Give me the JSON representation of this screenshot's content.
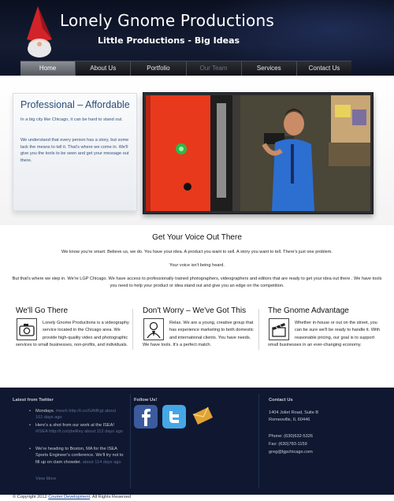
{
  "site": {
    "title": "Lonely Gnome Productions",
    "tagline": "Little Productions - Big Ideas"
  },
  "nav": {
    "items": [
      {
        "label": "Home",
        "active": true
      },
      {
        "label": "About Us"
      },
      {
        "label": "Portfolio"
      },
      {
        "label": "Our Team"
      },
      {
        "label": "Services"
      },
      {
        "label": "Contact Us"
      }
    ]
  },
  "intro": {
    "title": "Professional – Affordable",
    "p1": "In a big city like Chicago, it can be hard to stand out.",
    "p2": "We understand that every person has a story, but some lack the means to tell it. That's where we come in. We'll give you the tools to be seen and get your message out there."
  },
  "voice": {
    "title": "Get Your Voice Out There",
    "p1": "We know you're smart. Believe us, we do. You have your idea. A product you want to sell. A story you want to tell. There's just one problem.",
    "p2": "Your voice isn't being heard.",
    "p3": "But that's where we step in. We're LGP Chicago. We have access to professionally trained photographers, videographers and editors that are ready to get your idea out there . We have tools you need to help your product or idea stand out and give you an edge on the competition."
  },
  "columns": [
    {
      "title": "We'll Go There",
      "icon": "camera-icon",
      "text": "Lonely Gnome Productions is a videography service located in the Chicago area.  We provide high-quality video and photographic services to small businesses, non-profits, and individuals."
    },
    {
      "title": "Don't Worry – We've Got This",
      "icon": "person-icon",
      "text": "Relax. We are a young, creative group that has experience marketing to both domestic and international clients. You have needs. We have tools. It's a perfect match."
    },
    {
      "title": "The Gnome Advantage",
      "icon": "clapperboard-icon",
      "text": "Whether in-house or out on the street, you can be sure we'll be ready to handle it. With reasonable pricing, our goal is to support small businesses in an ever-changing economy."
    }
  ],
  "footer": {
    "twitter_heading": "Latest from Twitter",
    "tweets": [
      {
        "text": "Mondays.",
        "link": "#work http://t.co/GAtfKgt about 161 days ago"
      },
      {
        "text": "Here's a shot from our work at the ISEA!",
        "link": "#ISEA http://t.co/ybeRey about 112 days ago"
      },
      {
        "text": "We're heading to Boston, MA for the ISEA Sports Engineer's conference. We'll try not to fill up on clam chowder.",
        "link": "about 114 days ago"
      }
    ],
    "view_more": "View More",
    "follow_heading": "Follow Us!",
    "contact_heading": "Contact Us",
    "address1": "1404 Joliet Road, Suite B",
    "address2": "Romeoville, IL 60446",
    "phone": "Phone: (630)632-5326",
    "fax": "Fax: (630)783-1159",
    "email": "greg@lgpchicago.com"
  },
  "copyright": {
    "prefix": "© Copyright 2012",
    "link1": "Courier Development",
    "suffix": "All Rights Reserved"
  },
  "colors": {
    "header_bg": "#0b1020",
    "footer_bg": "#0f1830",
    "accent_blue": "#2a4d7a",
    "gnome_hat": "#d2232a"
  }
}
